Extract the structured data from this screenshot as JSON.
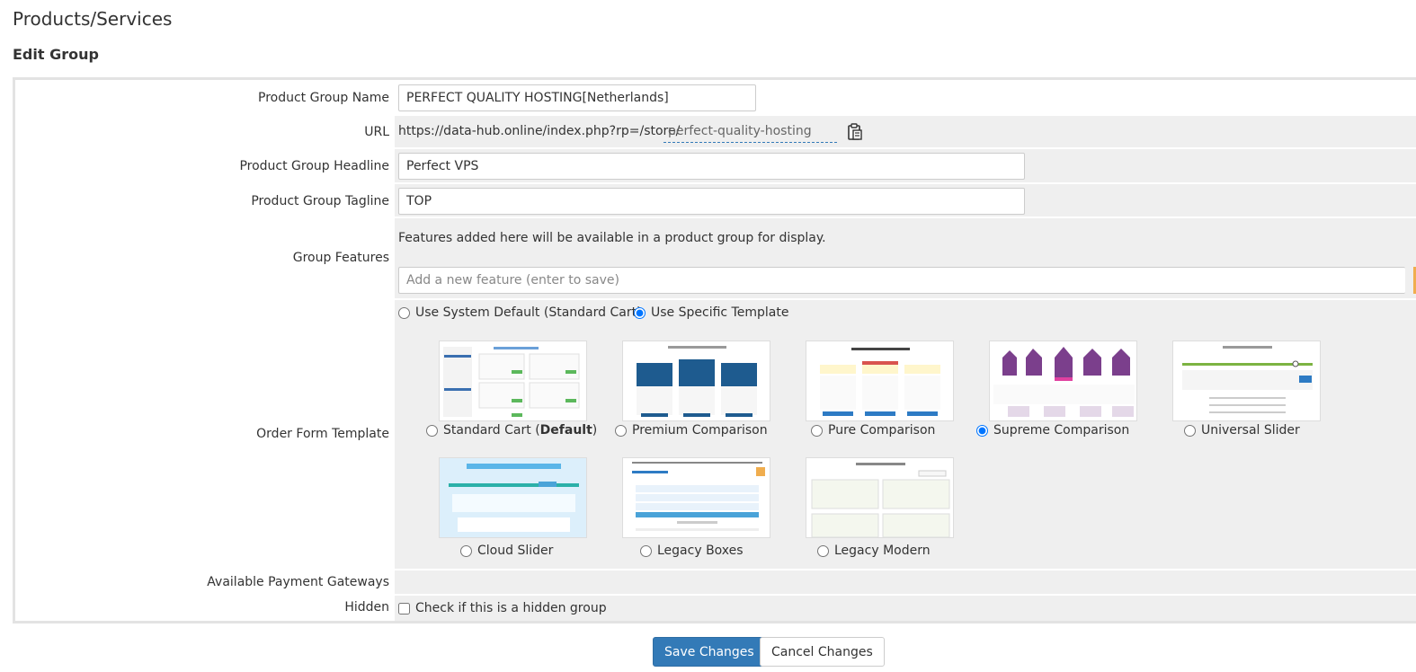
{
  "page": {
    "title": "Products/Services",
    "section_title": "Edit Group"
  },
  "form": {
    "group_name": {
      "label": "Product Group Name",
      "value": "PERFECT QUALITY HOSTING[Netherlands]"
    },
    "url": {
      "label": "URL",
      "prefix": "https://data-hub.online/index.php?rp=/store/",
      "slug": "perfect-quality-hosting",
      "copy_icon": "clipboard-icon"
    },
    "headline": {
      "label": "Product Group Headline",
      "value": "Perfect VPS"
    },
    "tagline": {
      "label": "Product Group Tagline",
      "value": "TOP"
    },
    "features": {
      "label": "Group Features",
      "help": "Features added here will be available in a product group for display.",
      "placeholder": "Add a new feature (enter to save)"
    },
    "order_form": {
      "label": "Order Form Template",
      "mode_options": [
        {
          "label": "Use System Default (Standard Cart)",
          "checked": false
        },
        {
          "label": "Use Specific Template",
          "checked": true
        }
      ],
      "templates": [
        {
          "name": "Standard Cart",
          "suffix": "Default",
          "checked": false
        },
        {
          "name": "Premium Comparison",
          "checked": false
        },
        {
          "name": "Pure Comparison",
          "checked": false
        },
        {
          "name": "Supreme Comparison",
          "checked": true
        },
        {
          "name": "Universal Slider",
          "checked": false
        },
        {
          "name": "Cloud Slider",
          "checked": false
        },
        {
          "name": "Legacy Boxes",
          "checked": false
        },
        {
          "name": "Legacy Modern",
          "checked": false
        }
      ]
    },
    "payment_gateways": {
      "label": "Available Payment Gateways"
    },
    "hidden": {
      "label": "Hidden",
      "checkbox_label": "Check if this is a hidden group",
      "checked": false
    }
  },
  "buttons": {
    "save": "Save Changes",
    "cancel": "Cancel Changes"
  },
  "colors": {
    "primary": "#337ab7",
    "feature_button": "#f0ad4e",
    "field_background": "#efefef"
  }
}
